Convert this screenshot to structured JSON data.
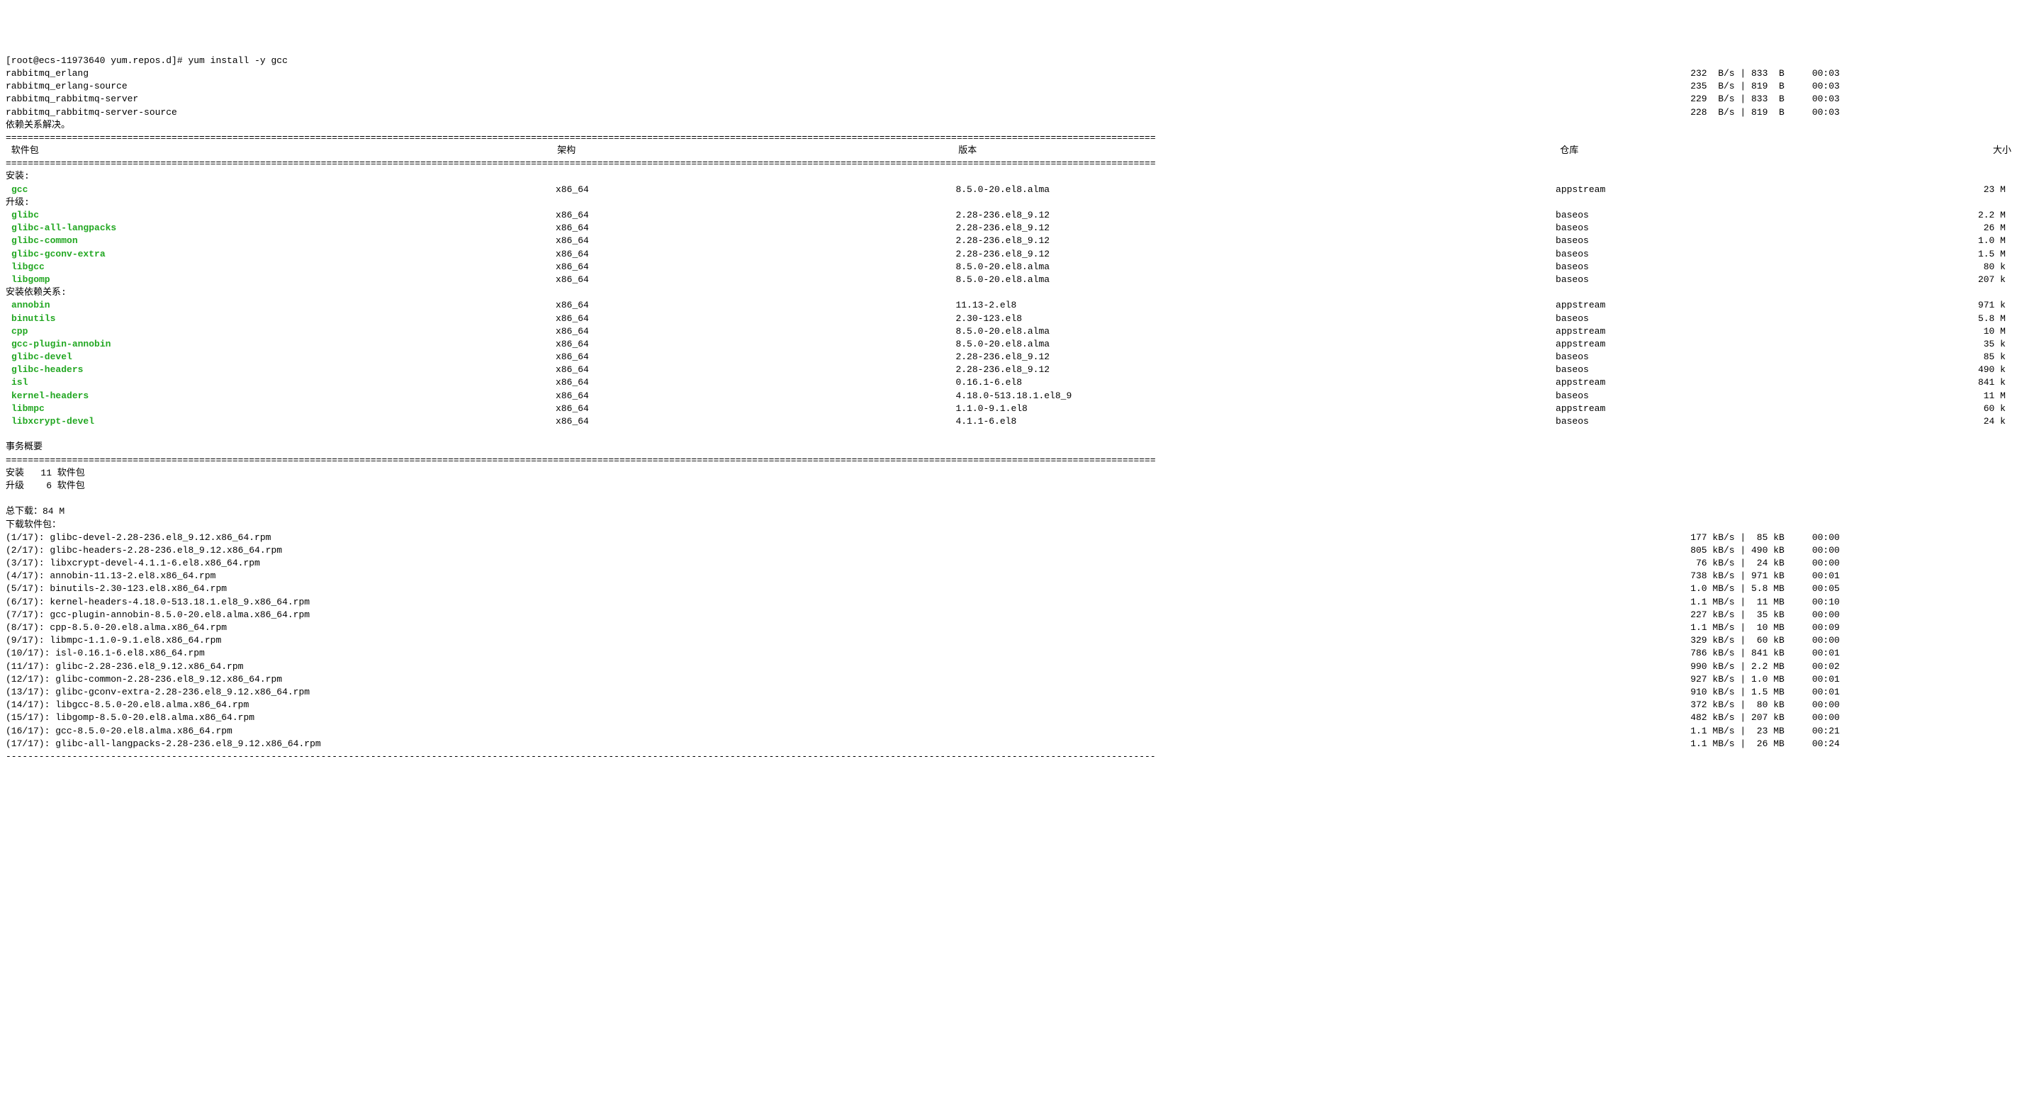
{
  "prompt": "[root@ecs-11973640 yum.repos.d]# ",
  "command": "yum install -y gcc",
  "repo_checks": [
    {
      "name": "rabbitmq_erlang",
      "stat": "232  B/s | 833  B     00:03"
    },
    {
      "name": "rabbitmq_erlang-source",
      "stat": "235  B/s | 819  B     00:03"
    },
    {
      "name": "rabbitmq_rabbitmq-server",
      "stat": "229  B/s | 833  B     00:03"
    },
    {
      "name": "rabbitmq_rabbitmq-server-source",
      "stat": "228  B/s | 819  B     00:03"
    }
  ],
  "deps_resolved": "依赖关系解决。",
  "hdr_rule": "================================================================================================================================================================================================================",
  "headers": {
    "pkg": " 软件包",
    "arch": "架构",
    "ver": "版本",
    "repo": "仓库",
    "size": "大小"
  },
  "section_install": "安装:",
  "section_upgrade": "升级:",
  "section_install_deps": "安装依赖关系:",
  "install": [
    {
      "name": "gcc",
      "arch": "x86_64",
      "ver": "8.5.0-20.el8.alma",
      "repo": "appstream",
      "size": " 23 M"
    }
  ],
  "upgrade": [
    {
      "name": "glibc",
      "arch": "x86_64",
      "ver": "2.28-236.el8_9.12",
      "repo": "baseos",
      "size": "2.2 M"
    },
    {
      "name": "glibc-all-langpacks",
      "arch": "x86_64",
      "ver": "2.28-236.el8_9.12",
      "repo": "baseos",
      "size": " 26 M"
    },
    {
      "name": "glibc-common",
      "arch": "x86_64",
      "ver": "2.28-236.el8_9.12",
      "repo": "baseos",
      "size": "1.0 M"
    },
    {
      "name": "glibc-gconv-extra",
      "arch": "x86_64",
      "ver": "2.28-236.el8_9.12",
      "repo": "baseos",
      "size": "1.5 M"
    },
    {
      "name": "libgcc",
      "arch": "x86_64",
      "ver": "8.5.0-20.el8.alma",
      "repo": "baseos",
      "size": " 80 k"
    },
    {
      "name": "libgomp",
      "arch": "x86_64",
      "ver": "8.5.0-20.el8.alma",
      "repo": "baseos",
      "size": "207 k"
    }
  ],
  "install_deps": [
    {
      "name": "annobin",
      "arch": "x86_64",
      "ver": "11.13-2.el8",
      "repo": "appstream",
      "size": "971 k"
    },
    {
      "name": "binutils",
      "arch": "x86_64",
      "ver": "2.30-123.el8",
      "repo": "baseos",
      "size": "5.8 M"
    },
    {
      "name": "cpp",
      "arch": "x86_64",
      "ver": "8.5.0-20.el8.alma",
      "repo": "appstream",
      "size": " 10 M"
    },
    {
      "name": "gcc-plugin-annobin",
      "arch": "x86_64",
      "ver": "8.5.0-20.el8.alma",
      "repo": "appstream",
      "size": " 35 k"
    },
    {
      "name": "glibc-devel",
      "arch": "x86_64",
      "ver": "2.28-236.el8_9.12",
      "repo": "baseos",
      "size": " 85 k"
    },
    {
      "name": "glibc-headers",
      "arch": "x86_64",
      "ver": "2.28-236.el8_9.12",
      "repo": "baseos",
      "size": "490 k"
    },
    {
      "name": "isl",
      "arch": "x86_64",
      "ver": "0.16.1-6.el8",
      "repo": "appstream",
      "size": "841 k"
    },
    {
      "name": "kernel-headers",
      "arch": "x86_64",
      "ver": "4.18.0-513.18.1.el8_9",
      "repo": "baseos",
      "size": " 11 M"
    },
    {
      "name": "libmpc",
      "arch": "x86_64",
      "ver": "1.1.0-9.1.el8",
      "repo": "appstream",
      "size": " 60 k"
    },
    {
      "name": "libxcrypt-devel",
      "arch": "x86_64",
      "ver": "4.1.1-6.el8",
      "repo": "baseos",
      "size": " 24 k"
    }
  ],
  "tx_summary_title": "事务概要",
  "summary_rule": "================================================================================================================================================================================================================",
  "tx_install_line": "安装   11 软件包",
  "tx_upgrade_line": "升级    6 软件包",
  "total_download": "总下载：84 M",
  "downloading_pkgs": "下载软件包：",
  "downloads": [
    {
      "name": "(1/17): glibc-devel-2.28-236.el8_9.12.x86_64.rpm",
      "stat": "177 kB/s |  85 kB     00:00"
    },
    {
      "name": "(2/17): glibc-headers-2.28-236.el8_9.12.x86_64.rpm",
      "stat": "805 kB/s | 490 kB     00:00"
    },
    {
      "name": "(3/17): libxcrypt-devel-4.1.1-6.el8.x86_64.rpm",
      "stat": " 76 kB/s |  24 kB     00:00"
    },
    {
      "name": "(4/17): annobin-11.13-2.el8.x86_64.rpm",
      "stat": "738 kB/s | 971 kB     00:01"
    },
    {
      "name": "(5/17): binutils-2.30-123.el8.x86_64.rpm",
      "stat": "1.0 MB/s | 5.8 MB     00:05"
    },
    {
      "name": "(6/17): kernel-headers-4.18.0-513.18.1.el8_9.x86_64.rpm",
      "stat": "1.1 MB/s |  11 MB     00:10"
    },
    {
      "name": "(7/17): gcc-plugin-annobin-8.5.0-20.el8.alma.x86_64.rpm",
      "stat": "227 kB/s |  35 kB     00:00"
    },
    {
      "name": "(8/17): cpp-8.5.0-20.el8.alma.x86_64.rpm",
      "stat": "1.1 MB/s |  10 MB     00:09"
    },
    {
      "name": "(9/17): libmpc-1.1.0-9.1.el8.x86_64.rpm",
      "stat": "329 kB/s |  60 kB     00:00"
    },
    {
      "name": "(10/17): isl-0.16.1-6.el8.x86_64.rpm",
      "stat": "786 kB/s | 841 kB     00:01"
    },
    {
      "name": "(11/17): glibc-2.28-236.el8_9.12.x86_64.rpm",
      "stat": "990 kB/s | 2.2 MB     00:02"
    },
    {
      "name": "(12/17): glibc-common-2.28-236.el8_9.12.x86_64.rpm",
      "stat": "927 kB/s | 1.0 MB     00:01"
    },
    {
      "name": "(13/17): glibc-gconv-extra-2.28-236.el8_9.12.x86_64.rpm",
      "stat": "910 kB/s | 1.5 MB     00:01"
    },
    {
      "name": "(14/17): libgcc-8.5.0-20.el8.alma.x86_64.rpm",
      "stat": "372 kB/s |  80 kB     00:00"
    },
    {
      "name": "(15/17): libgomp-8.5.0-20.el8.alma.x86_64.rpm",
      "stat": "482 kB/s | 207 kB     00:00"
    },
    {
      "name": "(16/17): gcc-8.5.0-20.el8.alma.x86_64.rpm",
      "stat": "1.1 MB/s |  23 MB     00:21"
    },
    {
      "name": "(17/17): glibc-all-langpacks-2.28-236.el8_9.12.x86_64.rpm",
      "stat": "1.1 MB/s |  26 MB     00:24"
    }
  ],
  "bottom_rule": "----------------------------------------------------------------------------------------------------------------------------------------------------------------------------------------------------------------"
}
